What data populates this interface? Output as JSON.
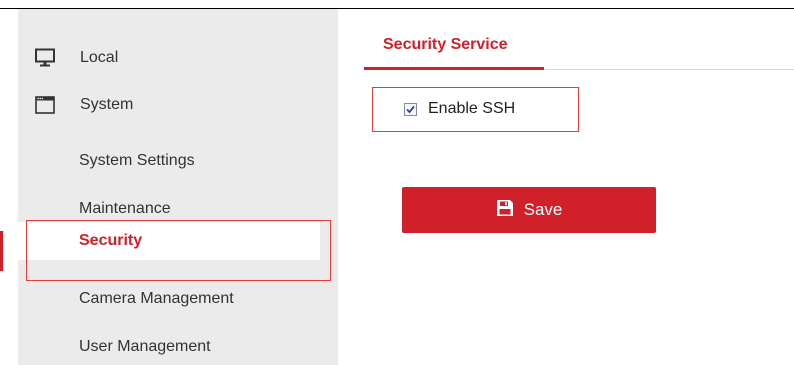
{
  "sidebar": {
    "items": [
      {
        "label": "Local",
        "icon": "monitor-icon"
      },
      {
        "label": "System",
        "icon": "window-icon"
      },
      {
        "label": "System Settings"
      },
      {
        "label": "Maintenance"
      },
      {
        "label": "Security",
        "active": true
      },
      {
        "label": "Camera Management"
      },
      {
        "label": "User Management"
      }
    ]
  },
  "main": {
    "tab_label": "Security Service",
    "ssh": {
      "label": "Enable SSH",
      "checked": true
    },
    "save_label": "Save",
    "save_icon": "floppy-disk-icon"
  },
  "colors": {
    "accent": "#d0202a",
    "highlight_border": "#e53b3b",
    "sidebar_bg": "#ebebeb"
  }
}
